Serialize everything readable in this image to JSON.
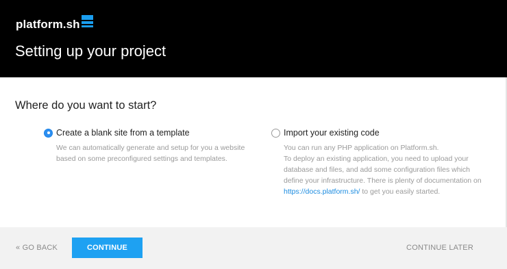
{
  "header": {
    "logo_text": "platform.sh",
    "logo_icon": "stacked-bars-icon",
    "title": "Setting up your project",
    "background_color": "#000000",
    "brand_color": "#1a9ef0"
  },
  "main": {
    "question": "Where do you want to start?",
    "options": [
      {
        "label": "Create a blank site from a template",
        "selected": true,
        "description": "We can automatically generate and setup for you a website based on some preconfigured settings and templates."
      },
      {
        "label": "Import your existing code",
        "selected": false,
        "description_line1": "You can run any PHP application on Platform.sh.",
        "description_line2": "To deploy an existing application, you need to upload your database and files, and add some configuration files which define your infrastructure. There is plenty of documentation on",
        "link_text": "https://docs.platform.sh/",
        "description_after_link": " to get you easily started."
      }
    ]
  },
  "footer": {
    "back_label": "« GO BACK",
    "continue_label": "CONTINUE",
    "continue_later_label": "CONTINUE LATER",
    "accent_color": "#1ea1f2"
  }
}
